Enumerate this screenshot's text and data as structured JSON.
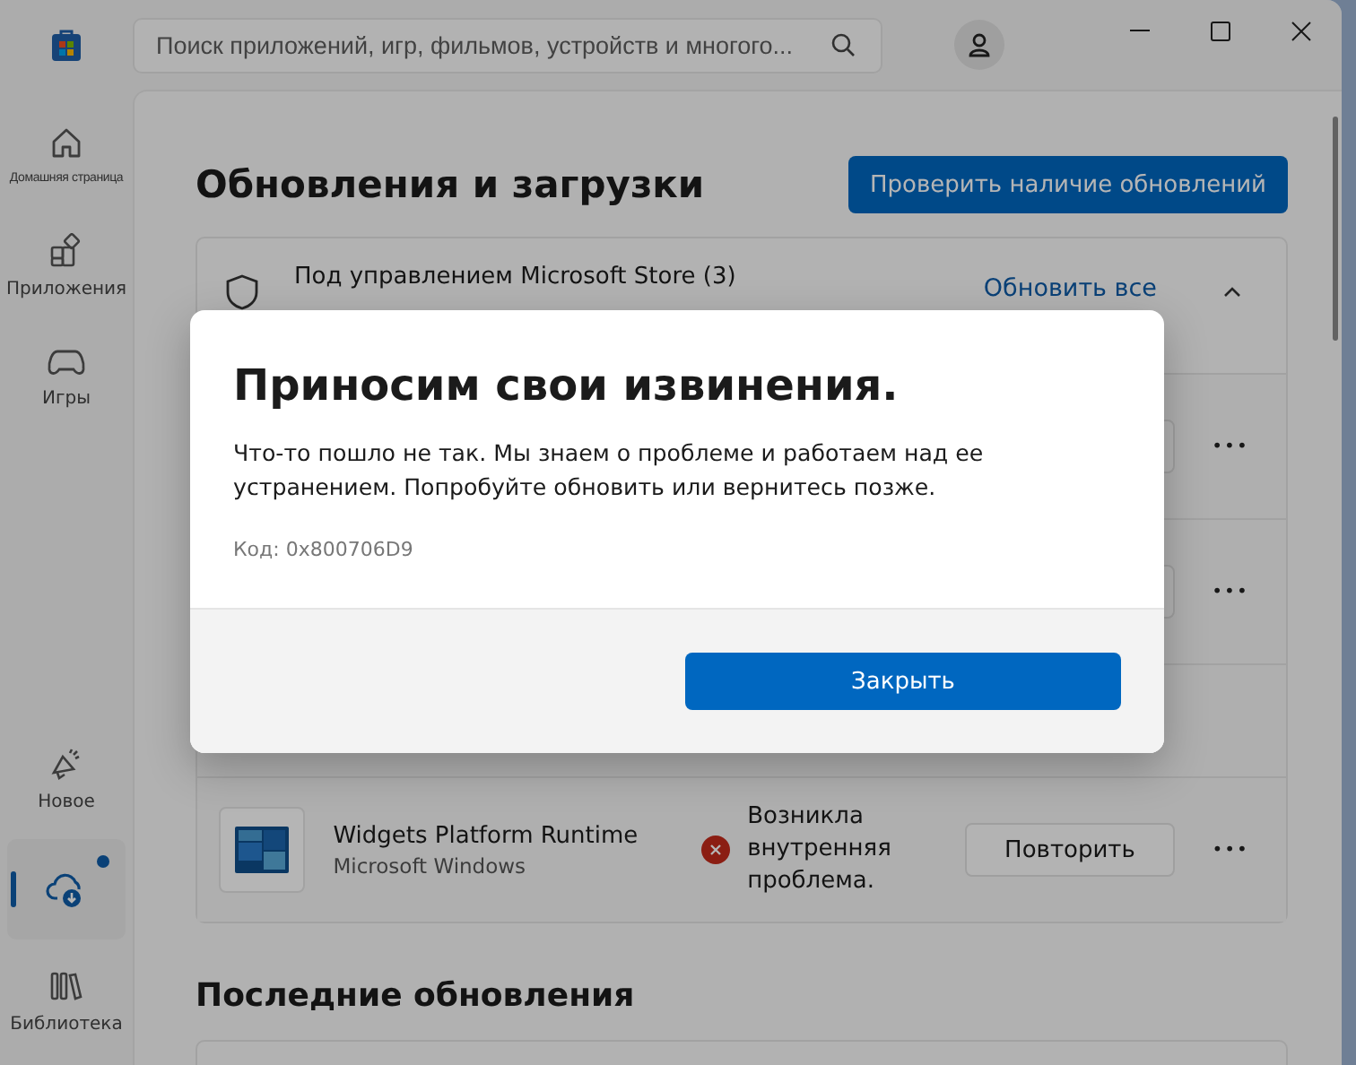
{
  "search": {
    "placeholder": "Поиск приложений, игр, фильмов, устройств и многого..."
  },
  "sidebar": {
    "items": [
      {
        "kind": "home",
        "label": "Домашняя страница",
        "selected": false,
        "badge": false
      },
      {
        "kind": "apps",
        "label": "Приложения",
        "selected": false,
        "badge": false
      },
      {
        "kind": "games",
        "label": "Игры",
        "selected": false,
        "badge": false
      },
      {
        "kind": "whatsnew",
        "label": "Новое",
        "selected": false,
        "badge": false
      },
      {
        "kind": "downloads",
        "selected": true,
        "badge": true
      },
      {
        "kind": "library",
        "label": "Библиотека",
        "selected": false,
        "badge": false
      }
    ]
  },
  "page": {
    "title": "Обновления и загрузки",
    "check_button": "Проверить наличие обновлений"
  },
  "managed": {
    "title": "Под управлением Microsoft Store (3)",
    "update_all": "Обновить все",
    "expanded": true,
    "rows": [
      {
        "kind": "covered",
        "more": "•••"
      },
      {
        "kind": "covered",
        "more": "•••"
      },
      {
        "kind": "blank"
      },
      {
        "kind": "app",
        "name": "Widgets Platform Runtime",
        "publisher": "Microsoft Windows",
        "error": true,
        "status_text": "Возникла внутренняя проблема.",
        "button": "Повторить",
        "more": "•••"
      }
    ]
  },
  "recent": {
    "title": "Последние обновления"
  },
  "dialog": {
    "title": "Приносим свои извинения.",
    "message": "Что-то пошло не так. Мы знаем о проблеме и работаем над ее устранением. Попробуйте обновить или вернитесь позже.",
    "code": "Код: 0x800706D9",
    "button": "Закрыть"
  }
}
